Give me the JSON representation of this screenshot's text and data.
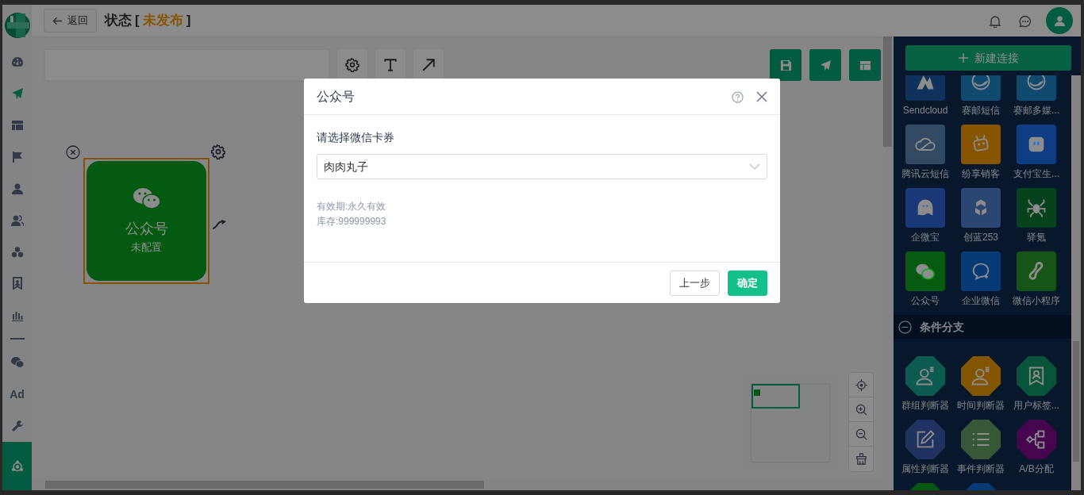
{
  "sidebar": {
    "items": [
      {
        "kind": "icon",
        "selected": false,
        "current": false
      },
      {
        "kind": "icon",
        "selected": true,
        "current": false
      },
      {
        "kind": "icon",
        "selected": false,
        "current": false
      },
      {
        "kind": "icon",
        "selected": false,
        "current": false
      },
      {
        "kind": "icon",
        "selected": false,
        "current": false
      },
      {
        "kind": "icon",
        "selected": false,
        "current": false
      },
      {
        "kind": "icon",
        "selected": false,
        "current": false
      },
      {
        "kind": "icon",
        "selected": false,
        "current": false
      },
      {
        "kind": "icon",
        "selected": false,
        "current": false
      },
      {
        "kind": "divider"
      },
      {
        "kind": "icon",
        "selected": false,
        "current": false
      },
      {
        "kind": "text",
        "text": "Ad",
        "selected": false,
        "current": false
      },
      {
        "kind": "icon",
        "selected": false,
        "current": false
      },
      {
        "kind": "icon",
        "selected": false,
        "current": true
      }
    ]
  },
  "header": {
    "back_button": "返回",
    "title": "状态",
    "bracket_open": "[",
    "status": "未发布",
    "bracket_close": "]"
  },
  "canvas": {
    "node": {
      "title": "公众号",
      "subtitle": "未配置",
      "selected": true
    }
  },
  "right_panel": {
    "new_button": "新建连接",
    "channels": [
      {
        "label": "Sendcloud",
        "color": "#0f325c"
      },
      {
        "label": "赛邮短信",
        "color": "#104a6f"
      },
      {
        "label": "赛邮多媒...",
        "color": "#104a6f"
      },
      {
        "label": "腾讯云短信",
        "color": "#324a61"
      },
      {
        "label": "纷享销客",
        "color": "#875500"
      },
      {
        "label": "支付宝生...",
        "color": "#0e3d84"
      },
      {
        "label": "企微宝",
        "color": "#1a3877"
      },
      {
        "label": "创蓝253",
        "color": "#2b4672"
      },
      {
        "label": "驿氪",
        "color": "#06431d"
      },
      {
        "label": "公众号",
        "color": "#065b11"
      },
      {
        "label": "企业微信",
        "color": "#063b76"
      },
      {
        "label": "微信小程序",
        "color": "#175517"
      }
    ],
    "condition_section": {
      "title": "条件分支",
      "expanded": true,
      "items": [
        {
          "label": "群组判断器",
          "color": "#0b5b51"
        },
        {
          "label": "时间判断器",
          "color": "#845500"
        },
        {
          "label": "用户标签...",
          "color": "#085539"
        },
        {
          "label": "属性判断器",
          "color": "#20325f"
        },
        {
          "label": "事件判断器",
          "color": "#365836"
        },
        {
          "label": "A/B分配",
          "color": "#45064e"
        },
        {
          "color": "#06570f"
        },
        {
          "color": "#063b76"
        }
      ]
    }
  },
  "modal": {
    "title": "公众号",
    "field_label": "请选择微信卡券",
    "select_value": "肉肉丸子",
    "info": [
      "有效期:永久有效",
      "库存:999999993"
    ],
    "buttons": [
      {
        "label": "上一步",
        "kind": "secondary"
      },
      {
        "label": "确定",
        "kind": "primary"
      }
    ]
  }
}
